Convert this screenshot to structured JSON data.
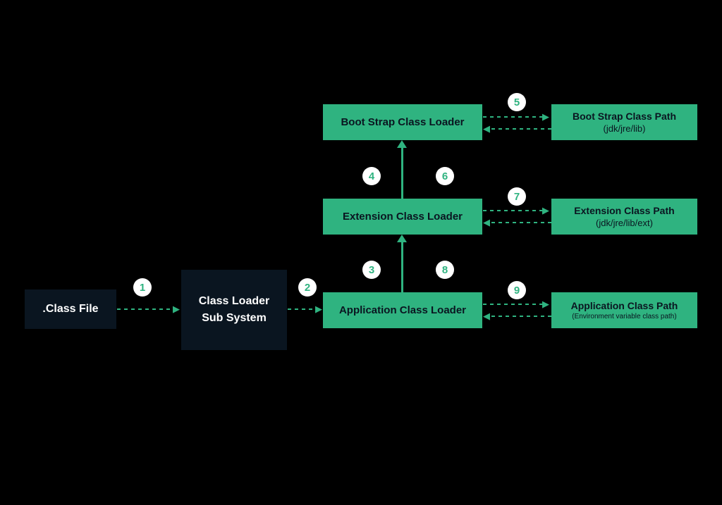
{
  "boxes": {
    "classFile": ".Class File",
    "classLoaderSubSystem": {
      "line1": "Class Loader",
      "line2": "Sub System"
    },
    "bootStrapLoader": "Boot Strap Class Loader",
    "extensionLoader": "Extension Class Loader",
    "applicationLoader": "Application Class Loader",
    "bootStrapPath": {
      "title": "Boot Strap Class Path",
      "sub": "(jdk/jre/lib)"
    },
    "extensionPath": {
      "title": "Extension Class Path",
      "sub": "(jdk/jre/lib/ext)"
    },
    "applicationPath": {
      "title": "Application Class Path",
      "sub": "(Environment variable class path)"
    }
  },
  "steps": {
    "s1": "1",
    "s2": "2",
    "s3": "3",
    "s4": "4",
    "s5": "5",
    "s6": "6",
    "s7": "7",
    "s8": "8",
    "s9": "9"
  }
}
